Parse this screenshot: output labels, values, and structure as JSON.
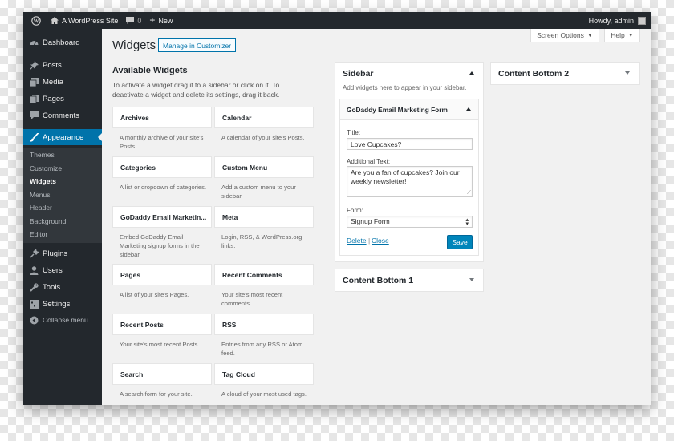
{
  "adminbar": {
    "site_name": "A WordPress Site",
    "comments_count": "0",
    "new_label": "New",
    "howdy": "Howdy, admin"
  },
  "menu": {
    "dashboard": "Dashboard",
    "posts": "Posts",
    "media": "Media",
    "pages": "Pages",
    "comments": "Comments",
    "appearance": "Appearance",
    "sub": [
      "Themes",
      "Customize",
      "Widgets",
      "Menus",
      "Header",
      "Background",
      "Editor"
    ],
    "plugins": "Plugins",
    "users": "Users",
    "tools": "Tools",
    "settings": "Settings",
    "collapse": "Collapse menu"
  },
  "header": {
    "title": "Widgets",
    "manage": "Manage in Customizer",
    "screen_options": "Screen Options",
    "help": "Help"
  },
  "available": {
    "title": "Available Widgets",
    "desc": "To activate a widget drag it to a sidebar or click on it. To deactivate a widget and delete its settings, drag it back.",
    "widgets": [
      {
        "name": "Archives",
        "desc": "A monthly archive of your site's Posts."
      },
      {
        "name": "Calendar",
        "desc": "A calendar of your site's Posts."
      },
      {
        "name": "Categories",
        "desc": "A list or dropdown of categories."
      },
      {
        "name": "Custom Menu",
        "desc": "Add a custom menu to your sidebar."
      },
      {
        "name": "GoDaddy Email Marketin...",
        "desc": "Embed GoDaddy Email Marketing signup forms in the sidebar."
      },
      {
        "name": "Meta",
        "desc": "Login, RSS, & WordPress.org links."
      },
      {
        "name": "Pages",
        "desc": "A list of your site's Pages."
      },
      {
        "name": "Recent Comments",
        "desc": "Your site's most recent comments."
      },
      {
        "name": "Recent Posts",
        "desc": "Your site's most recent Posts."
      },
      {
        "name": "RSS",
        "desc": "Entries from any RSS or Atom feed."
      },
      {
        "name": "Search",
        "desc": "A search form for your site."
      },
      {
        "name": "Tag Cloud",
        "desc": "A cloud of your most used tags."
      }
    ]
  },
  "sidebar": {
    "title": "Sidebar",
    "desc": "Add widgets here to appear in your sidebar.",
    "widget": {
      "title": "GoDaddy Email Marketing Form",
      "title_label": "Title:",
      "title_value": "Love Cupcakes?",
      "text_label": "Additional Text:",
      "text_value": "Are you a fan of cupcakes? Join our weekly newsletter!",
      "form_label": "Form:",
      "form_value": "Signup Form",
      "delete": "Delete",
      "separator": "|",
      "close": "Close",
      "save": "Save"
    }
  },
  "content_bottom_1": {
    "title": "Content Bottom 1"
  },
  "content_bottom_2": {
    "title": "Content Bottom 2"
  }
}
